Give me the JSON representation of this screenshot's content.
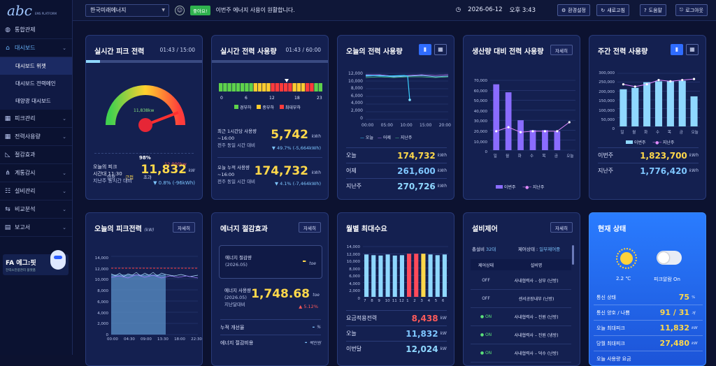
{
  "app": {
    "logo": "abc",
    "logo_sub": "EMS PLATFORM"
  },
  "sidebar": {
    "items": [
      {
        "label": "통합관제",
        "icon": "globe-icon"
      },
      {
        "label": "대시보드",
        "icon": "home-icon"
      },
      {
        "label": "피크관리",
        "icon": "grid-icon"
      },
      {
        "label": "전력사용량",
        "icon": "grid-icon"
      },
      {
        "label": "절감효과",
        "icon": "chart-icon"
      },
      {
        "label": "계통감시",
        "icon": "network-icon"
      },
      {
        "label": "설비관리",
        "icon": "settings-icon"
      },
      {
        "label": "비교분석",
        "icon": "compare-icon"
      },
      {
        "label": "보고서",
        "icon": "report-icon"
      }
    ],
    "sub": [
      "대시보드 위젯",
      "대시보드 전력메인",
      "태양광 대시보드"
    ],
    "banner_title": "FA 에그:핏",
    "banner_sub": "전력소진량관리 플랫폼"
  },
  "topbar": {
    "company": "한국미래에너지",
    "status_badge": "좋아요!",
    "message": "이번주 에너지 사용이 원활합니다.",
    "date": "2026-06-12",
    "time": "오후 3:43",
    "buttons": [
      "환경설정",
      "새로고침",
      "도움말",
      "로그아웃"
    ]
  },
  "peak": {
    "title": "실시간 피크 전력",
    "time": "01:43 / 15:00",
    "gauge_top": "11,838kw",
    "gauge_pct": "98%",
    "gauge_pct_value": 0.98,
    "gauge_max": "12,000kw",
    "legend": [
      "안정",
      "근접",
      "초과"
    ],
    "label1": "오늘의 피크",
    "label2": "시간대 11:30",
    "value": "11,832",
    "unit": "kW",
    "cmp_label": "지난주 동시간 대비",
    "cmp": "▼ 0.8% (-96kWh)"
  },
  "usage": {
    "title": "실시간 전력 사용량",
    "time": "01:43 / 60:00",
    "ticks": [
      "0",
      "6",
      "12",
      "18",
      "23"
    ],
    "legend": [
      "경부하",
      "중부하",
      "최대부하"
    ],
    "r1l1": "최근 1시간당 사용량",
    "r1l2": "~16:00",
    "r1l3": "전주 동일 시간 대비",
    "r1v": "5,742",
    "r1u": "kWh",
    "r1c": "▼ 49.7% (-5,664kWh)",
    "r2l1": "오늘 누적 사용량",
    "r2l2": "~16:00",
    "r2l3": "전주 동일 시간 대비",
    "r2v": "174,732",
    "r2u": "kWh",
    "r2c": "▼ 4.1% (-7,464kWh)"
  },
  "today": {
    "title": "오늘의 전력 사용량",
    "yticks": [
      "12,000",
      "10,000",
      "8,000",
      "6,000",
      "4,000",
      "2,000",
      "0"
    ],
    "xticks": [
      "00:00",
      "05:00",
      "10:00",
      "15:00",
      "20:00"
    ],
    "legend": [
      "오늘",
      "어제",
      "지난주"
    ],
    "rows": [
      {
        "k": "오늘",
        "v": "174,732",
        "u": "kWh"
      },
      {
        "k": "어제",
        "v": "261,600",
        "u": "kWh"
      },
      {
        "k": "지난주",
        "v": "270,726",
        "u": "kWh"
      }
    ]
  },
  "prod": {
    "title": "생산량 대비 전력 사용량",
    "btn": "자세히",
    "yticks": [
      "70,000",
      "60,000",
      "50,000",
      "40,000",
      "30,000",
      "20,000",
      "10,000",
      "0"
    ],
    "days": [
      "일",
      "월",
      "화",
      "수",
      "목",
      "금",
      "오늘"
    ],
    "legend": [
      "이번주",
      "지난주"
    ]
  },
  "weekly": {
    "title": "주간 전력 사용량",
    "yticks": [
      "300,000",
      "250,000",
      "200,000",
      "150,000",
      "100,000",
      "50,000",
      "0"
    ],
    "days": [
      "일",
      "월",
      "화",
      "수",
      "목",
      "금",
      "오늘"
    ],
    "legend": [
      "이번주",
      "지난주"
    ],
    "rows": [
      {
        "k": "이번주",
        "v": "1,823,700",
        "u": "kWh"
      },
      {
        "k": "지난주",
        "v": "1,776,420",
        "u": "kWh"
      }
    ]
  },
  "todaypeak": {
    "title": "오늘의 피크전력",
    "unit": "(kW)",
    "btn": "자세히",
    "yticks": [
      "14,000",
      "12,000",
      "10,000",
      "8,000",
      "6,000",
      "4,000",
      "2,000",
      "0"
    ],
    "xticks": [
      "00:00",
      "04:30",
      "09:00",
      "13:30",
      "18:00",
      "22:30"
    ]
  },
  "saving": {
    "title": "에너지 절감효과",
    "btn": "자세히",
    "b1l1": "에너지 절감량",
    "b1l2": "(2026.05)",
    "b1v": "-",
    "b1u": "toe",
    "b2l1": "에너지 사용량",
    "b2l2": "(2026.05)",
    "b2l3": "지난달대비",
    "b2v": "1,748.68",
    "b2u": "toe",
    "b2c": "▲ 5.12%",
    "r1": "누적 개선율",
    "r1v": "-",
    "r1u": "%",
    "r2": "에너지 절감비용",
    "r2v": "-",
    "r2u": "백만원"
  },
  "monthly": {
    "title": "월별 최대수요",
    "yticks": [
      "14,000",
      "12,000",
      "10,000",
      "8,000",
      "6,000",
      "4,000",
      "2,000",
      "0"
    ],
    "months": [
      "7",
      "8",
      "9",
      "10",
      "11",
      "12",
      "1",
      "2",
      "3",
      "4",
      "5",
      "6"
    ],
    "rows": [
      {
        "k": "요금적용전력",
        "v": "8,438",
        "u": "kW"
      },
      {
        "k": "오늘",
        "v": "11,832",
        "u": "kW"
      },
      {
        "k": "이번달",
        "v": "12,024",
        "u": "kW"
      }
    ]
  },
  "equip": {
    "title": "설비제어",
    "btn": "자세히",
    "total_label": "총설비",
    "total": "32대",
    "state_label": "제어상태 :",
    "state": "일부제어중",
    "cols": [
      "제어상태",
      "설비명"
    ],
    "rows": [
      {
        "s": "OFF",
        "n": "사내협력사 – 삼부 (난방)"
      },
      {
        "s": "OFF",
        "n": "센서공장내부 (난방)"
      },
      {
        "s": "ON",
        "n": "사내협력사 – 진원 (난방)"
      },
      {
        "s": "ON",
        "n": "사내협력사 – 진원 (냉방)"
      },
      {
        "s": "ON",
        "n": "사내협력사 – 덕수 (난방)"
      },
      {
        "s": "ON",
        "n": "사내협력사 – 덕수 (냉방)"
      }
    ]
  },
  "status": {
    "title": "현재 상태",
    "temp": "2.2 ℃",
    "peak_mode": "피크알람 On",
    "rows": [
      {
        "k": "통신 상태",
        "v": "75",
        "u": "%"
      },
      {
        "k": "통신 양호 / 나쁨",
        "v": "91 / 31",
        "u": "개"
      },
      {
        "k": "오늘 최대피크",
        "v": "11,832",
        "u": "kW"
      },
      {
        "k": "당월 최대피크",
        "v": "27,480",
        "u": "kW"
      },
      {
        "k": "오늘 사용량 요금",
        "v": "",
        "u": ""
      }
    ]
  },
  "chart_data": [
    {
      "type": "bar",
      "title": "생산량 대비 전력 사용량",
      "categories": [
        "일",
        "월",
        "화",
        "수",
        "목",
        "금",
        "오늘"
      ],
      "series": [
        {
          "name": "이번주",
          "values": [
            66000,
            58000,
            30000,
            20000,
            20000,
            19000,
            0
          ]
        },
        {
          "name": "지난주",
          "values": [
            19000,
            23000,
            18000,
            19000,
            19000,
            19000,
            28000
          ]
        }
      ],
      "ylim": [
        0,
        70000
      ]
    },
    {
      "type": "bar",
      "title": "주간 전력 사용량",
      "categories": [
        "일",
        "월",
        "화",
        "수",
        "목",
        "금",
        "오늘"
      ],
      "series": [
        {
          "name": "이번주",
          "values": [
            210000,
            218000,
            250000,
            255000,
            258000,
            258000,
            170000
          ]
        },
        {
          "name": "지난주",
          "values": [
            238000,
            225000,
            238000,
            262000,
            255000,
            262000,
            268000
          ]
        }
      ],
      "ylim": [
        0,
        300000
      ]
    },
    {
      "type": "bar",
      "title": "월별 최대수요",
      "categories": [
        "7",
        "8",
        "9",
        "10",
        "11",
        "12",
        "1",
        "2",
        "3",
        "4",
        "5",
        "6"
      ],
      "values": [
        11800,
        11600,
        11500,
        11800,
        11500,
        11600,
        12000,
        12000,
        12000,
        11800,
        11600,
        11800
      ],
      "ylim": [
        0,
        14000
      ]
    }
  ]
}
